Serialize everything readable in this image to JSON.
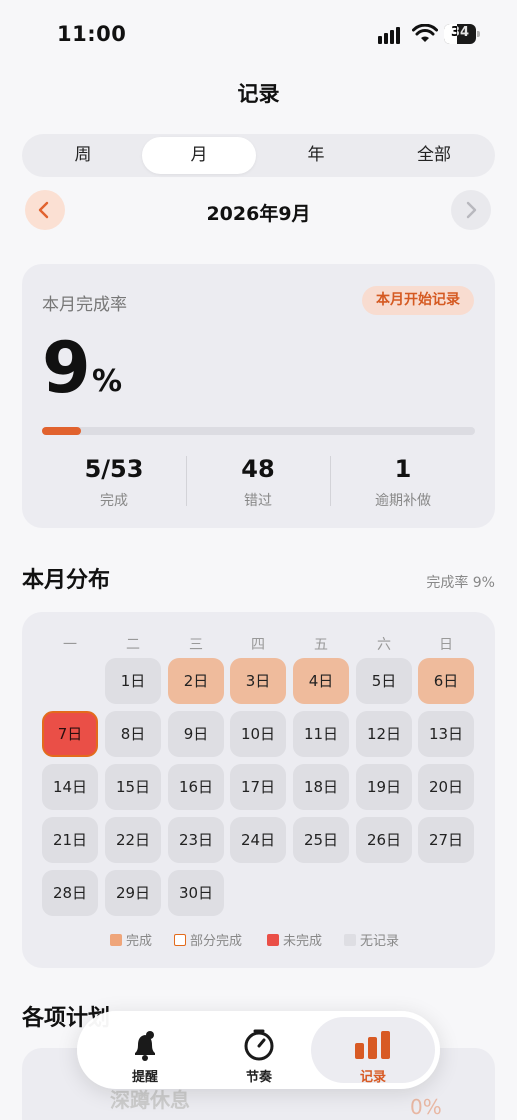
{
  "status_bar": {
    "time": "11:00",
    "battery": "34"
  },
  "header": {
    "title": "记录"
  },
  "segments": {
    "items": [
      "周",
      "月",
      "年",
      "全部"
    ],
    "selected": "月"
  },
  "month_nav": {
    "label": "2026年9月"
  },
  "summary": {
    "label": "本月完成率",
    "badge": "本月开始记录",
    "percent_value": "9",
    "percent_unit": "%",
    "progress": 0.09,
    "stats": [
      {
        "value": "5/53",
        "label": "完成"
      },
      {
        "value": "48",
        "label": "错过"
      },
      {
        "value": "1",
        "label": "逾期补做"
      }
    ]
  },
  "distribution": {
    "title": "本月分布",
    "rate_text": "完成率 9%",
    "weekdays": [
      "一",
      "二",
      "三",
      "四",
      "五",
      "六",
      "日"
    ],
    "days": [
      {
        "label": "1日",
        "status": "none"
      },
      {
        "label": "2日",
        "status": "done"
      },
      {
        "label": "3日",
        "status": "done"
      },
      {
        "label": "4日",
        "status": "done"
      },
      {
        "label": "5日",
        "status": "none"
      },
      {
        "label": "6日",
        "status": "done"
      },
      {
        "label": "7日",
        "status": "missed"
      },
      {
        "label": "8日",
        "status": "none"
      },
      {
        "label": "9日",
        "status": "none"
      },
      {
        "label": "10日",
        "status": "none"
      },
      {
        "label": "11日",
        "status": "none"
      },
      {
        "label": "12日",
        "status": "none"
      },
      {
        "label": "13日",
        "status": "none"
      },
      {
        "label": "14日",
        "status": "none"
      },
      {
        "label": "15日",
        "status": "none"
      },
      {
        "label": "16日",
        "status": "none"
      },
      {
        "label": "17日",
        "status": "none"
      },
      {
        "label": "18日",
        "status": "none"
      },
      {
        "label": "19日",
        "status": "none"
      },
      {
        "label": "20日",
        "status": "none"
      },
      {
        "label": "21日",
        "status": "none"
      },
      {
        "label": "22日",
        "status": "none"
      },
      {
        "label": "23日",
        "status": "none"
      },
      {
        "label": "24日",
        "status": "none"
      },
      {
        "label": "25日",
        "status": "none"
      },
      {
        "label": "26日",
        "status": "none"
      },
      {
        "label": "27日",
        "status": "none"
      },
      {
        "label": "28日",
        "status": "none"
      },
      {
        "label": "29日",
        "status": "none"
      },
      {
        "label": "30日",
        "status": "none"
      }
    ],
    "legend": [
      {
        "label": "完成",
        "color": "#efa57a"
      },
      {
        "label": "部分完成",
        "color": "#e36b1c"
      },
      {
        "label": "未完成",
        "color": "#ea4f47"
      },
      {
        "label": "无记录",
        "color": "#dedee3"
      }
    ]
  },
  "plans": {
    "title": "各项计划",
    "first_item": "深蹲休息",
    "first_pct": "0%"
  },
  "tabbar": {
    "items": [
      {
        "label": "提醒",
        "icon": "bell-icon"
      },
      {
        "label": "节奏",
        "icon": "timer-icon"
      },
      {
        "label": "记录",
        "icon": "chart-bars-icon"
      }
    ],
    "active": "记录"
  },
  "colors": {
    "accent": "#e1622e",
    "done": "#efbb9c",
    "missed": "#ea4f47"
  }
}
